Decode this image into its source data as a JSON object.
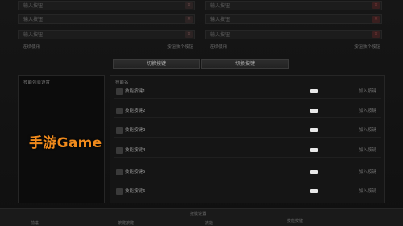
{
  "input_grid": {
    "placeholder": "输入按钮",
    "clear_icon": "close-icon",
    "left_fields": [
      "输入按钮",
      "输入按钮",
      "输入按钮"
    ],
    "right_fields": [
      "输入按钮",
      "输入按钮",
      "输入按钮"
    ],
    "left_footer_label": "连续使用",
    "left_footer_value": "按钮数个按钮",
    "right_footer_label": "连续使用",
    "right_footer_value": "按钮数个按钮"
  },
  "actions": {
    "primary_label": "切换按键",
    "secondary_label": "切换按键"
  },
  "left_panel": {
    "header": "技能列表设置"
  },
  "right_panel": {
    "header": "技能名",
    "rows": [
      {
        "name": "技能按键1",
        "option": "加入按键"
      },
      {
        "name": "技能按键2",
        "option": "加入按键"
      },
      {
        "name": "技能按键3",
        "option": "加入按键"
      },
      {
        "name": "技能按键4",
        "option": "加入按键"
      },
      {
        "name": "技能按键5",
        "option": "加入按键"
      },
      {
        "name": "技能按键6",
        "option": "加入按键"
      }
    ]
  },
  "watermark": "手游Game",
  "bottom": {
    "title": "按键设置",
    "col1": "前进",
    "col2": "按键按键",
    "col3": "技能",
    "col4": "技能按键"
  },
  "colors": {
    "accent": "#f08a1c",
    "background": "#141414"
  }
}
